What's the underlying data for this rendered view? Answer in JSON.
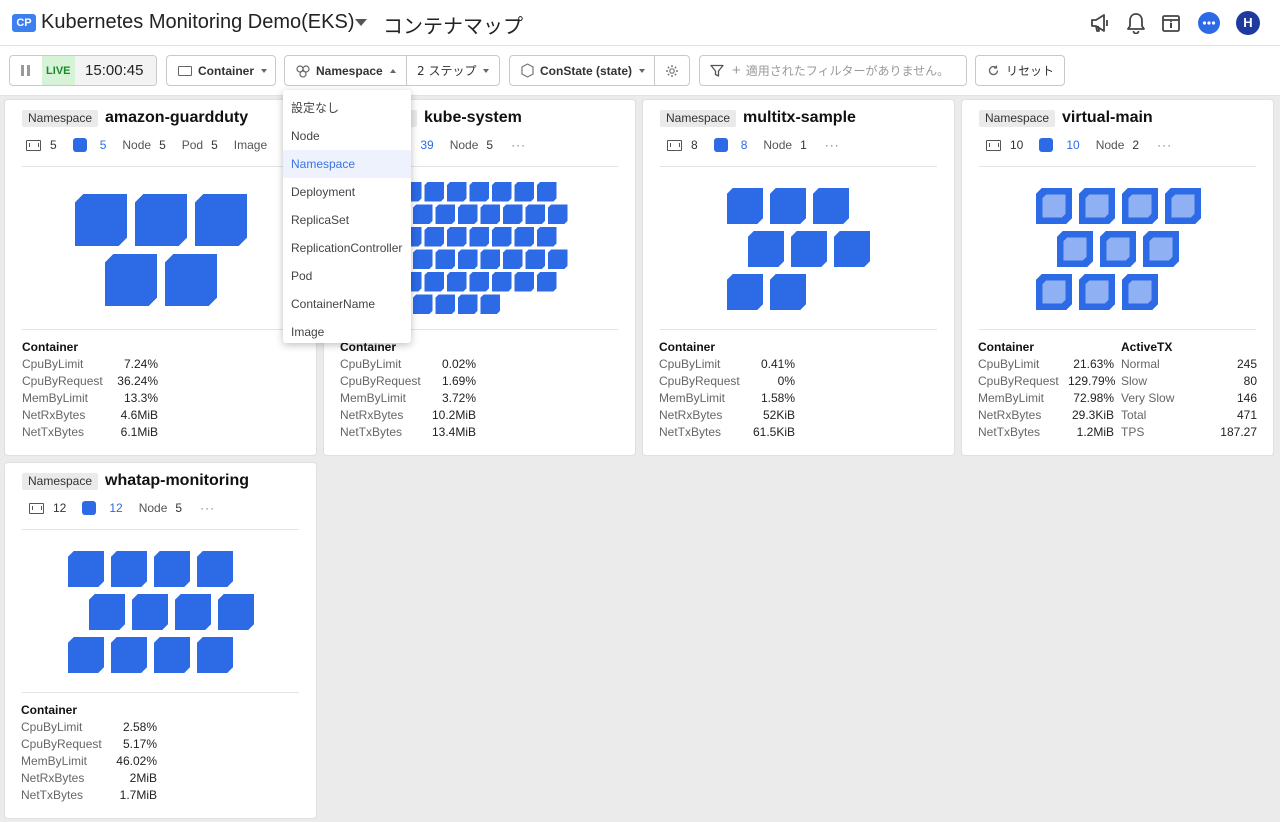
{
  "header": {
    "badge": "CP",
    "app_title": "Kubernetes Monitoring Demo(EKS)",
    "page_title": "コンテナマップ",
    "avatar_initial": "H",
    "icons": [
      "megaphone-icon",
      "bell-icon",
      "calendar-info-icon",
      "chat-icon"
    ]
  },
  "toolbar": {
    "live_label": "LIVE",
    "live_time": "15:00:45",
    "container_label": "Container",
    "group_by": "Namespace",
    "step_label": "2 ステップ",
    "state_label": "ConState (state)",
    "filter_placeholder": "適用されたフィルターがありません。",
    "reset_label": "リセット"
  },
  "dropdown": {
    "selected": "Namespace",
    "options": [
      "設定なし",
      "Node",
      "Namespace",
      "Deployment",
      "ReplicaSet",
      "ReplicationController",
      "Pod",
      "ContainerName",
      "Image"
    ]
  },
  "labels": {
    "namespace_tag": "Namespace",
    "node": "Node",
    "pod": "Pod",
    "image": "Image",
    "more": "···",
    "container_heading": "Container",
    "activetx_heading": "ActiveTX"
  },
  "colors": {
    "accent": "#2c6ae6",
    "live_bg": "#d7f3d7",
    "live_text": "#1a8a2a"
  },
  "cards": [
    {
      "name": "amazon-guardduty",
      "containers": "5",
      "active": "5",
      "node": "5",
      "pod": "5",
      "metrics": [
        {
          "k": "CpuByLimit",
          "v": "7.24%"
        },
        {
          "k": "CpuByRequest",
          "v": "36.24%"
        },
        {
          "k": "MemByLimit",
          "v": "13.3%"
        },
        {
          "k": "NetRxBytes",
          "v": "4.6MiB"
        },
        {
          "k": "NetTxBytes",
          "v": "6.1MiB"
        }
      ]
    },
    {
      "name": "kube-system",
      "containers": "39",
      "active": "39",
      "node": "5",
      "metrics": [
        {
          "k": "CpuByLimit",
          "v": "0.02%"
        },
        {
          "k": "CpuByRequest",
          "v": "1.69%"
        },
        {
          "k": "MemByLimit",
          "v": "3.72%"
        },
        {
          "k": "NetRxBytes",
          "v": "10.2MiB"
        },
        {
          "k": "NetTxBytes",
          "v": "13.4MiB"
        }
      ]
    },
    {
      "name": "multitx-sample",
      "containers": "8",
      "active": "8",
      "node": "1",
      "metrics": [
        {
          "k": "CpuByLimit",
          "v": "0.41%"
        },
        {
          "k": "CpuByRequest",
          "v": "0%"
        },
        {
          "k": "MemByLimit",
          "v": "1.58%"
        },
        {
          "k": "NetRxBytes",
          "v": "52KiB"
        },
        {
          "k": "NetTxBytes",
          "v": "61.5KiB"
        }
      ]
    },
    {
      "name": "virtual-main",
      "containers": "10",
      "active": "10",
      "node": "2",
      "metrics": [
        {
          "k": "CpuByLimit",
          "v": "21.63%"
        },
        {
          "k": "CpuByRequest",
          "v": "129.79%"
        },
        {
          "k": "MemByLimit",
          "v": "72.98%"
        },
        {
          "k": "NetRxBytes",
          "v": "29.3KiB"
        },
        {
          "k": "NetTxBytes",
          "v": "1.2MiB"
        }
      ],
      "activetx": [
        {
          "k": "Normal",
          "v": "245"
        },
        {
          "k": "Slow",
          "v": "80"
        },
        {
          "k": "Very Slow",
          "v": "146"
        },
        {
          "k": "Total",
          "v": "471"
        },
        {
          "k": "TPS",
          "v": "187.27"
        }
      ]
    },
    {
      "name": "whatap-monitoring",
      "containers": "12",
      "active": "12",
      "node": "5",
      "metrics": [
        {
          "k": "CpuByLimit",
          "v": "2.58%"
        },
        {
          "k": "CpuByRequest",
          "v": "5.17%"
        },
        {
          "k": "MemByLimit",
          "v": "46.02%"
        },
        {
          "k": "NetRxBytes",
          "v": "2MiB"
        },
        {
          "k": "NetTxBytes",
          "v": "1.7MiB"
        }
      ]
    }
  ]
}
